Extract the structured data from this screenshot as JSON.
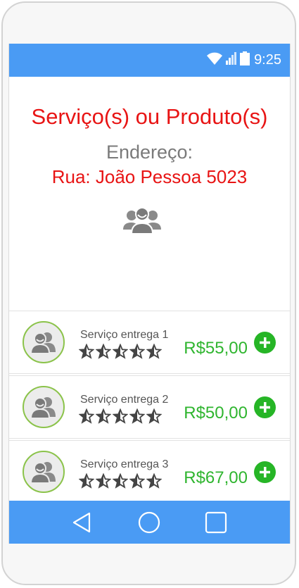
{
  "status_bar": {
    "time": "9:25",
    "icons": [
      "wifi-icon",
      "signal-icon",
      "battery-icon"
    ],
    "color": "#4a9bf4"
  },
  "header": {
    "title": "Serviço(s) ou Produto(s)",
    "address_label": "Endereço:",
    "address_value": "Rua: João Pessoa 5023",
    "icon": "users-icon"
  },
  "services": [
    {
      "name": "Serviço entrega 1",
      "price": "R$55,00",
      "rating": 0.5
    },
    {
      "name": "Serviço entrega 2",
      "price": "R$50,00",
      "rating": 0.5
    },
    {
      "name": "Serviço entrega 3",
      "price": "R$67,00",
      "rating": 0.5
    }
  ],
  "nav": {
    "buttons": [
      "back-icon",
      "home-icon",
      "recents-icon"
    ]
  },
  "colors": {
    "accent": "#4a9bf4",
    "title": "#e81414",
    "price": "#2fb52f",
    "avatar_border": "#8bc34a"
  }
}
